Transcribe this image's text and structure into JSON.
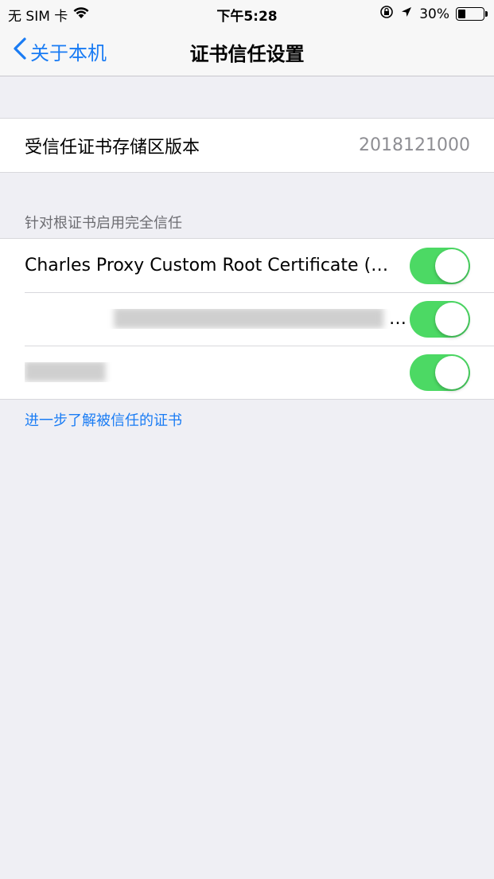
{
  "status_bar": {
    "carrier": "无 SIM 卡",
    "wifi_icon": "wifi-icon",
    "time": "下午5:28",
    "battery_percent": "30%",
    "battery_level": 0.3
  },
  "nav": {
    "back_label": "关于本机",
    "title": "证书信任设置"
  },
  "store_version": {
    "label": "受信任证书存储区版本",
    "value": "2018121000"
  },
  "trust_section": {
    "header": "针对根证书启用完全信任",
    "items": [
      {
        "label": "Charles Proxy Custom Root Certificate (…",
        "enabled": true
      },
      {
        "label": "…",
        "enabled": true
      },
      {
        "label": "",
        "enabled": true
      }
    ],
    "footer_link": "进一步了解被信任的证书"
  },
  "colors": {
    "accent": "#1a7cf4",
    "toggle_on": "#4cd964",
    "background": "#efeff4"
  }
}
